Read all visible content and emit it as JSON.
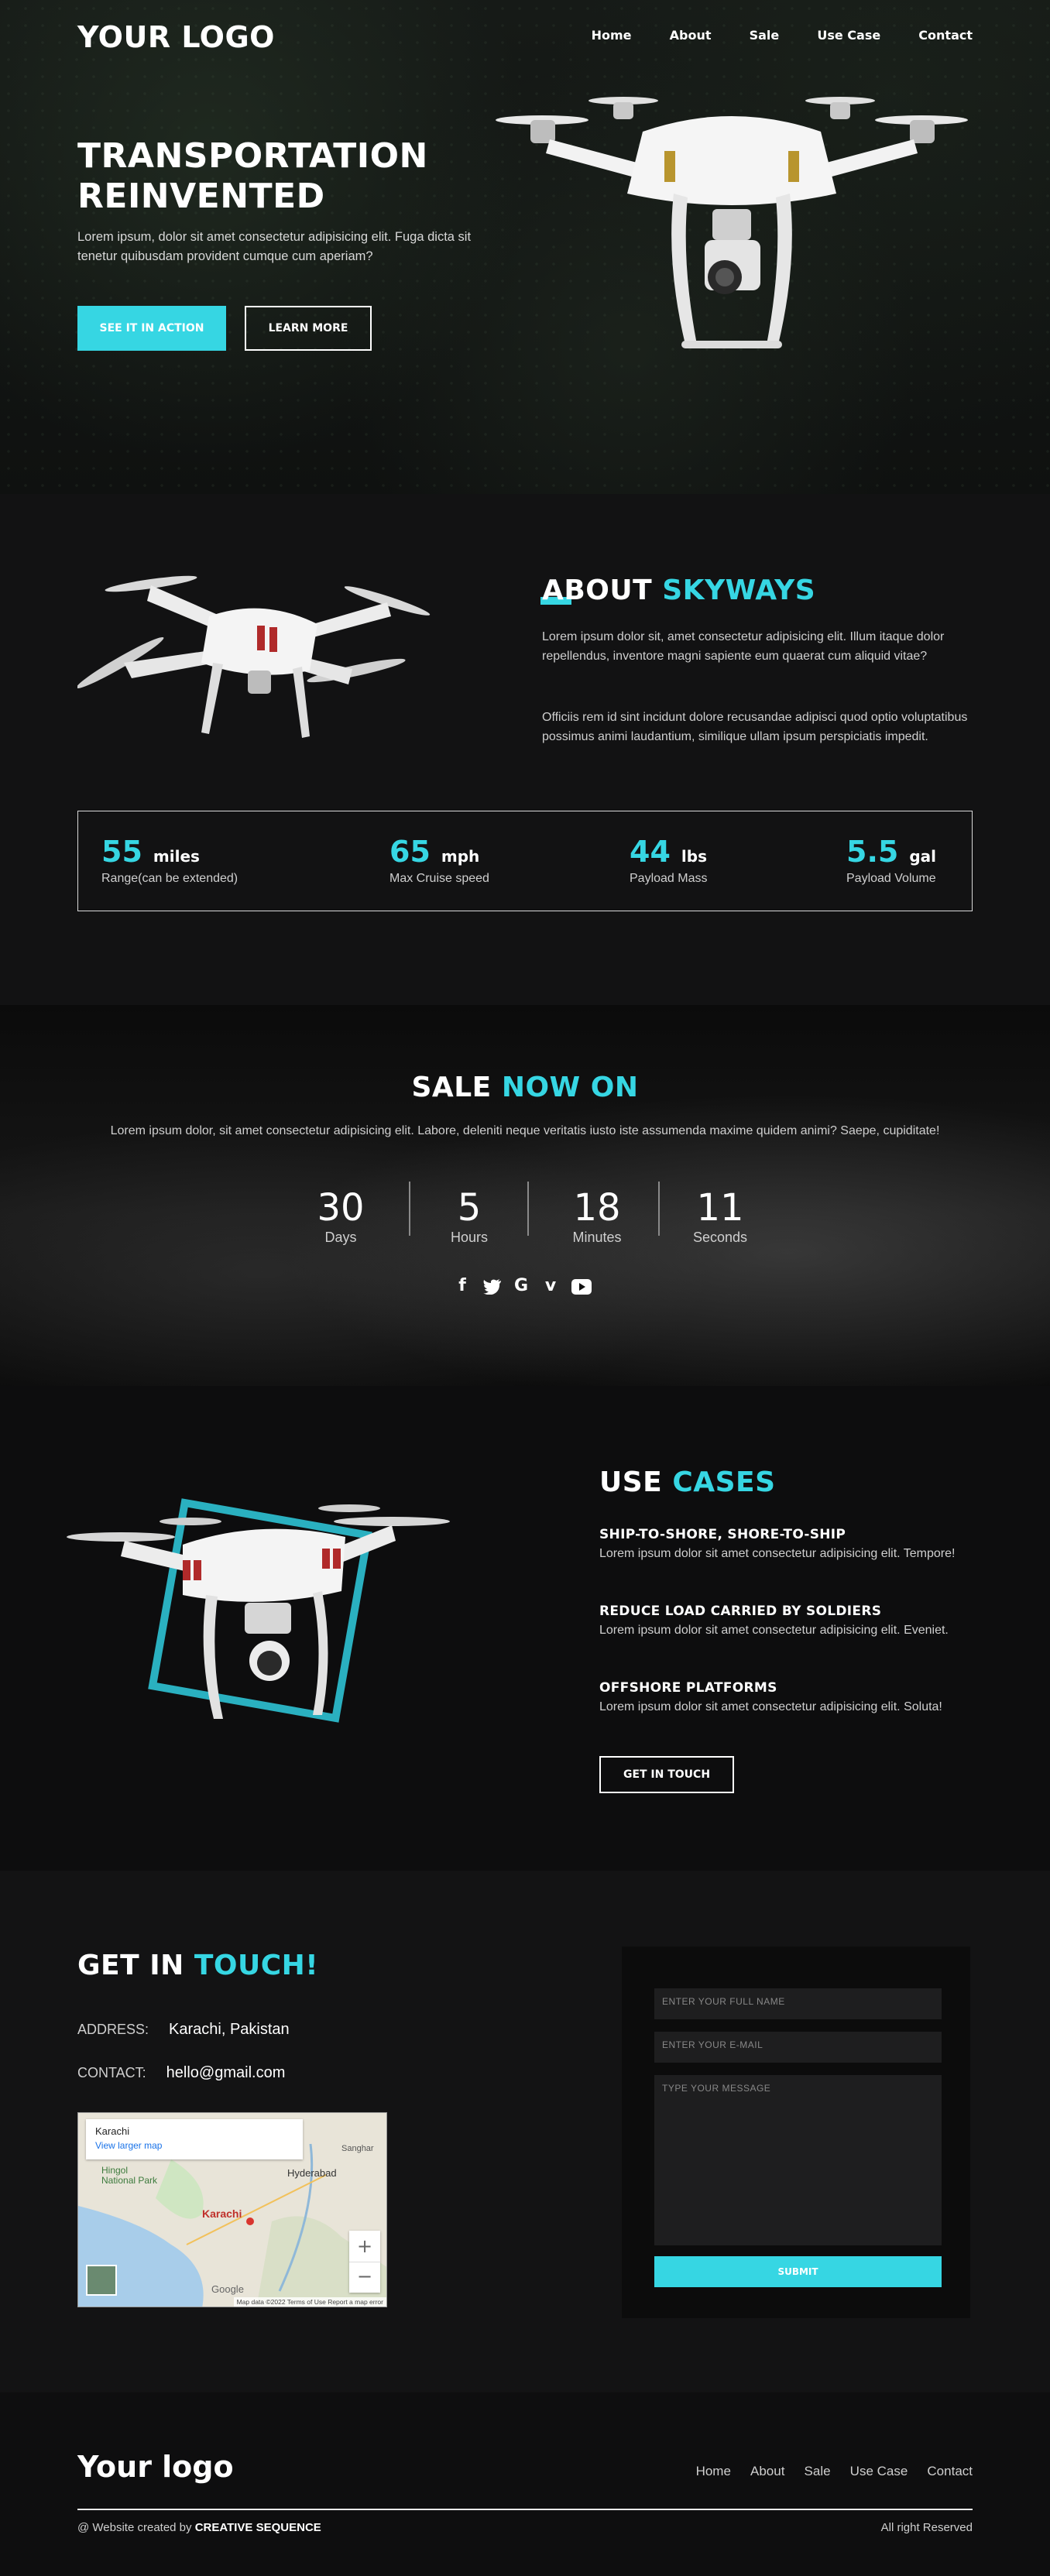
{
  "header": {
    "logo": "YOUR LOGO",
    "nav": [
      "Home",
      "About",
      "Sale",
      "Use Case",
      "Contact"
    ]
  },
  "hero": {
    "title_line1": "TRANSPORTATION",
    "title_line2": "REINVENTED",
    "text": "Lorem ipsum, dolor sit amet consectetur adipisicing elit. Fuga dicta sit tenetur quibusdam provident cumque cum aperiam?",
    "primary_button": "SEE IT IN ACTION",
    "secondary_button": "LEARN MORE"
  },
  "about": {
    "title_white": "ABOUT",
    "title_accent": "SKYWAYS",
    "para1": "Lorem ipsum dolor sit, amet consectetur adipisicing elit. Illum itaque dolor repellendus, inventore magni sapiente eum quaerat cum aliquid vitae?",
    "para2": "Officiis rem id sint incidunt dolore recusandae adipisci quod optio voluptatibus possimus animi laudantium, similique ullam ipsum perspiciatis impedit.",
    "stats": [
      {
        "value": "55",
        "unit": "miles",
        "label": "Range(can be extended)"
      },
      {
        "value": "65",
        "unit": "mph",
        "label": "Max Cruise speed"
      },
      {
        "value": "44",
        "unit": "lbs",
        "label": "Payload Mass"
      },
      {
        "value": "5.5",
        "unit": "gal",
        "label": "Payload Volume"
      }
    ]
  },
  "sale": {
    "title_white": "SALE",
    "title_accent": "NOW ON",
    "text": "Lorem ipsum dolor, sit amet consectetur adipisicing elit. Labore, deleniti neque veritatis iusto iste assumenda maxime quidem animi? Saepe, cupiditate!",
    "countdown": [
      {
        "value": "30",
        "label": "Days"
      },
      {
        "value": "5",
        "label": "Hours"
      },
      {
        "value": "18",
        "label": "Minutes"
      },
      {
        "value": "11",
        "label": "Seconds"
      }
    ],
    "social_icons": [
      "facebook-icon",
      "twitter-icon",
      "google-icon",
      "vimeo-icon",
      "youtube-icon"
    ]
  },
  "use_cases": {
    "title_white": "USE",
    "title_accent": "CASES",
    "items": [
      {
        "title": "SHIP-TO-SHORE, SHORE-TO-SHIP",
        "text": "Lorem ipsum dolor sit amet consectetur adipisicing elit. Tempore!"
      },
      {
        "title": "REDUCE LOAD CARRIED BY SOLDIERS",
        "text": "Lorem ipsum dolor sit amet consectetur adipisicing elit. Eveniet."
      },
      {
        "title": "OFFSHORE PLATFORMS",
        "text": "Lorem ipsum dolor sit amet consectetur adipisicing elit. Soluta!"
      }
    ],
    "button": "GET IN TOUCH"
  },
  "contact": {
    "title_white": "GET IN",
    "title_accent": "TOUCH!",
    "address_label": "ADDRESS:",
    "address_value": "Karachi, Pakistan",
    "contact_label": "CONTACT:",
    "contact_value": "hello@gmail.com",
    "map": {
      "place": "Karachi",
      "link": "View larger map",
      "labels": [
        "Hingol National Park",
        "Hyderabad",
        "Karachi",
        "Sanghar",
        "Google"
      ],
      "footer": "Map data ©2022   Terms of Use   Report a map error"
    },
    "form": {
      "name_placeholder": "ENTER YOUR FULL NAME",
      "email_placeholder": "ENTER YOUR E-MAIL",
      "message_placeholder": "TYPE YOUR MESSAGE",
      "submit": "SUBMIT"
    }
  },
  "footer": {
    "logo": "Your logo",
    "nav": [
      "Home",
      "About",
      "Sale",
      "Use Case",
      "Contact"
    ],
    "credit_prefix": "@ Website created by",
    "credit_brand": "CREATIVE SEQUENCE",
    "rights": "All right Reserved"
  },
  "colors": {
    "accent": "#36d6e3",
    "background": "#0e0e0f"
  }
}
